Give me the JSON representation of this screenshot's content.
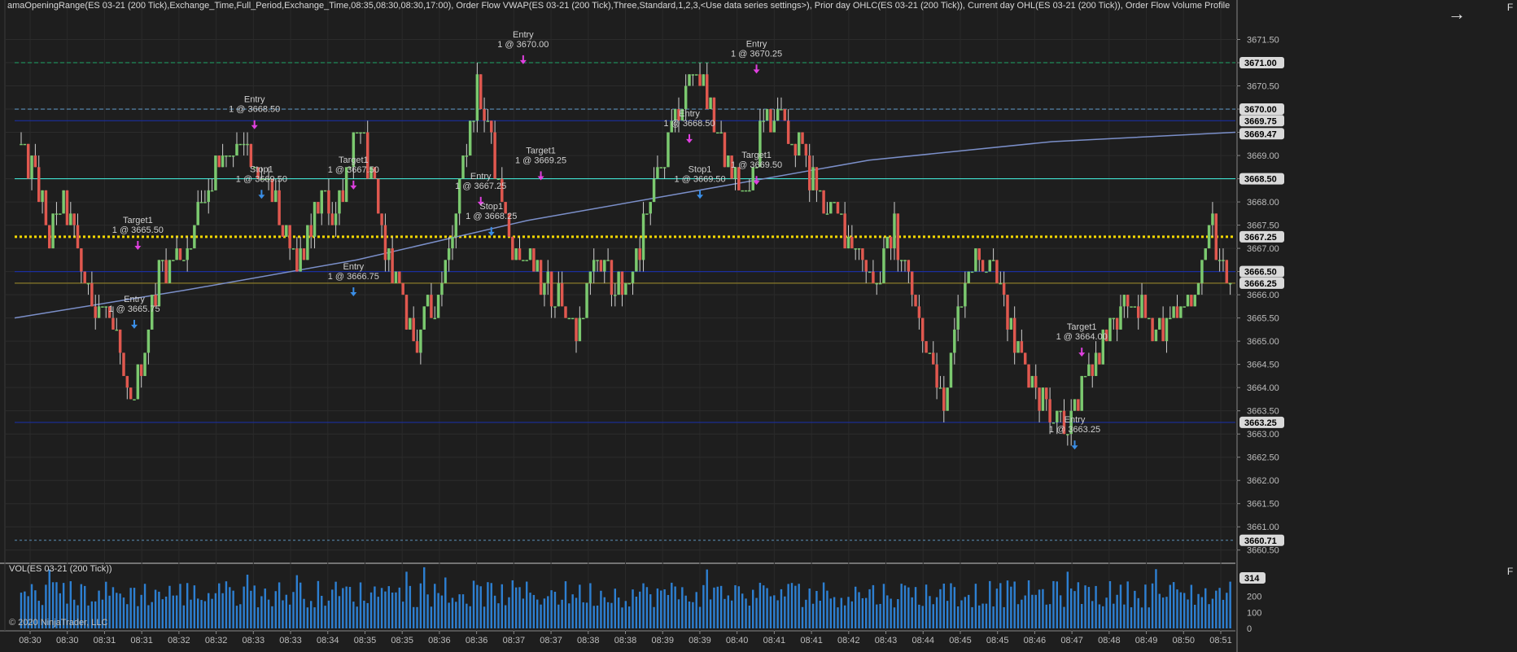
{
  "indicator_title": "amaOpeningRange(ES 03-21 (200 Tick),Exchange_Time,Full_Period,Exchange_Time,08:35,08:30,08:30,17:00), Order Flow VWAP(ES 03-21 (200 Tick),Three,Standard,1,2,3,<Use data series settings>), Prior day OHLC(ES 03-21 (200 Tick)), Current day OHL(ES 03-21 (200 Tick)), Order Flow Volume Profile",
  "volume_title": "VOL(ES 03-21 (200 Tick))",
  "copyright": "© 2020 NinjaTrader, LLC",
  "panel_buttons": {
    "f_label": "F",
    "nav_arrow": "→"
  },
  "colors": {
    "background": "#1e1e1e",
    "up_candle": "#7bc96f",
    "down_candle": "#e0584f",
    "vwap": "#7b8fc9",
    "cyan_level": "#40e0d0",
    "yellow_level": "#f5d800",
    "navy_level": "#1a2e9e",
    "volume_bar": "#2d7fd1",
    "entry_marker": "#e040e0",
    "exit_marker": "#3a8ee6"
  },
  "chart_data": {
    "type": "candlestick",
    "price_axis": {
      "ylim": [
        3660.25,
        3672.0
      ],
      "ticks": [
        "3671.50",
        "3671.00",
        "3670.50",
        "3670.00",
        "3669.50",
        "3669.00",
        "3668.50",
        "3668.00",
        "3667.50",
        "3667.00",
        "3666.50",
        "3666.00",
        "3665.50",
        "3665.00",
        "3664.50",
        "3664.00",
        "3663.50",
        "3663.00",
        "3662.50",
        "3662.00",
        "3661.50",
        "3661.00",
        "3660.50"
      ]
    },
    "time_axis": {
      "labels": [
        "08:30",
        "08:30",
        "08:31",
        "08:31",
        "08:32",
        "08:32",
        "08:33",
        "08:33",
        "08:34",
        "08:35",
        "08:35",
        "08:36",
        "08:36",
        "08:37",
        "08:37",
        "08:38",
        "08:38",
        "08:39",
        "08:39",
        "08:40",
        "08:41",
        "08:41",
        "08:42",
        "08:43",
        "08:44",
        "08:45",
        "08:45",
        "08:46",
        "08:47",
        "08:48",
        "08:49",
        "08:50",
        "08:51"
      ]
    },
    "levels": [
      {
        "price": 3671.0,
        "label": "3671.00",
        "color": "#1f8a5a",
        "style": "dashed"
      },
      {
        "price": 3670.0,
        "label": "3670.00",
        "color": "#5b8fb8",
        "style": "dashed"
      },
      {
        "price": 3669.75,
        "label": "3669.75",
        "color": "#1a2e9e",
        "style": "solid"
      },
      {
        "price": 3669.47,
        "label": "3669.47",
        "color": "#7b8fc9",
        "style": "vwap"
      },
      {
        "price": 3668.5,
        "label": "3668.50",
        "color": "#40e0d0",
        "style": "solid"
      },
      {
        "price": 3667.25,
        "label": "3667.25",
        "color": "#f5d800",
        "style": "dotted"
      },
      {
        "price": 3666.5,
        "label": "3666.50",
        "color": "#1a2e9e",
        "style": "solid"
      },
      {
        "price": 3666.25,
        "label": "3666.25",
        "color": "#8a7a2a",
        "style": "solid"
      },
      {
        "price": 3663.25,
        "label": "3663.25",
        "color": "#1a2e9e",
        "style": "solid"
      },
      {
        "price": 3660.71,
        "label": "3660.71",
        "color": "#5b8fb8",
        "style": "dotted"
      }
    ],
    "vwap": [
      {
        "t": 0.0,
        "v": 3665.5
      },
      {
        "t": 0.14,
        "v": 3666.1
      },
      {
        "t": 0.28,
        "v": 3666.75
      },
      {
        "t": 0.42,
        "v": 3667.6
      },
      {
        "t": 0.56,
        "v": 3668.25
      },
      {
        "t": 0.7,
        "v": 3668.9
      },
      {
        "t": 0.85,
        "v": 3669.3
      },
      {
        "t": 1.0,
        "v": 3669.5
      }
    ],
    "series": [
      {
        "name": "Price",
        "anchors": [
          [
            0,
            3669.25
          ],
          [
            5,
            3668.5
          ],
          [
            9,
            3667.25
          ],
          [
            13,
            3668.0
          ],
          [
            20,
            3666.0
          ],
          [
            25,
            3665.75
          ],
          [
            32,
            3663.5
          ],
          [
            40,
            3666.5
          ],
          [
            48,
            3667.0
          ],
          [
            58,
            3669.25
          ],
          [
            65,
            3669.0
          ],
          [
            72,
            3668.0
          ],
          [
            79,
            3666.5
          ],
          [
            86,
            3668.0
          ],
          [
            90,
            3667.75
          ],
          [
            96,
            3669.75
          ],
          [
            104,
            3667.0
          ],
          [
            112,
            3665.0
          ],
          [
            119,
            3666.0
          ],
          [
            124,
            3668.0
          ],
          [
            130,
            3670.5
          ],
          [
            140,
            3667.0
          ],
          [
            150,
            3666.25
          ],
          [
            158,
            3665.25
          ],
          [
            164,
            3666.75
          ],
          [
            172,
            3666.0
          ],
          [
            180,
            3668.25
          ],
          [
            186,
            3669.75
          ],
          [
            192,
            3671.0
          ],
          [
            200,
            3669.0
          ],
          [
            206,
            3668.0
          ],
          [
            212,
            3670.0
          ],
          [
            220,
            3669.25
          ],
          [
            228,
            3668.0
          ],
          [
            238,
            3667.0
          ],
          [
            243,
            3666.25
          ],
          [
            248,
            3667.5
          ],
          [
            256,
            3665.0
          ],
          [
            262,
            3663.75
          ],
          [
            268,
            3666.5
          ],
          [
            275,
            3667.0
          ],
          [
            282,
            3665.0
          ],
          [
            290,
            3663.75
          ],
          [
            298,
            3663.25
          ],
          [
            308,
            3665.25
          ],
          [
            316,
            3665.75
          ],
          [
            324,
            3665.25
          ],
          [
            332,
            3666.0
          ],
          [
            338,
            3667.5
          ],
          [
            342,
            3666.0
          ]
        ]
      }
    ],
    "volume": {
      "ticks": [
        "314",
        "200",
        "100",
        "0"
      ],
      "latest": 314,
      "ylim": [
        0,
        380
      ]
    },
    "annotations": [
      {
        "label": "Target1",
        "detail": "1 @ 3665.50",
        "bar": 33,
        "price": 3667.3,
        "kind": "target"
      },
      {
        "label": "Entry",
        "detail": "1 @ 3665.75",
        "bar": 32,
        "price": 3665.6,
        "kind": "entry"
      },
      {
        "label": "Entry",
        "detail": "1 @ 3668.50",
        "bar": 66,
        "price": 3669.9,
        "kind": "entry"
      },
      {
        "label": "Stop1",
        "detail": "1 @ 3669.50",
        "bar": 68,
        "price": 3668.4,
        "kind": "stop"
      },
      {
        "label": "Target1",
        "detail": "1 @ 3667.50",
        "bar": 94,
        "price": 3668.6,
        "kind": "target"
      },
      {
        "label": "Entry",
        "detail": "1 @ 3666.75",
        "bar": 94,
        "price": 3666.3,
        "kind": "entry"
      },
      {
        "label": "Entry",
        "detail": "1 @ 3667.25",
        "bar": 130,
        "price": 3668.25,
        "kind": "entry"
      },
      {
        "label": "Stop1",
        "detail": "1 @ 3668.25",
        "bar": 133,
        "price": 3667.6,
        "kind": "stop"
      },
      {
        "label": "Entry",
        "detail": "1 @ 3670.00",
        "bar": 142,
        "price": 3671.3,
        "kind": "entry"
      },
      {
        "label": "Target1",
        "detail": "1 @ 3669.25",
        "bar": 147,
        "price": 3668.8,
        "kind": "target"
      },
      {
        "label": "Entry",
        "detail": "1 @ 3668.50",
        "bar": 189,
        "price": 3669.6,
        "kind": "entry"
      },
      {
        "label": "Stop1",
        "detail": "1 @ 3669.50",
        "bar": 192,
        "price": 3668.4,
        "kind": "stop"
      },
      {
        "label": "Entry",
        "detail": "1 @ 3670.25",
        "bar": 208,
        "price": 3671.1,
        "kind": "entry"
      },
      {
        "label": "Target1",
        "detail": "1 @ 3669.50",
        "bar": 208,
        "price": 3668.7,
        "kind": "target"
      },
      {
        "label": "Target1",
        "detail": "1 @ 3664.00",
        "bar": 300,
        "price": 3665.0,
        "kind": "target"
      },
      {
        "label": "Entry",
        "detail": "1 @ 3663.25",
        "bar": 298,
        "price": 3663.0,
        "kind": "entry"
      }
    ]
  }
}
